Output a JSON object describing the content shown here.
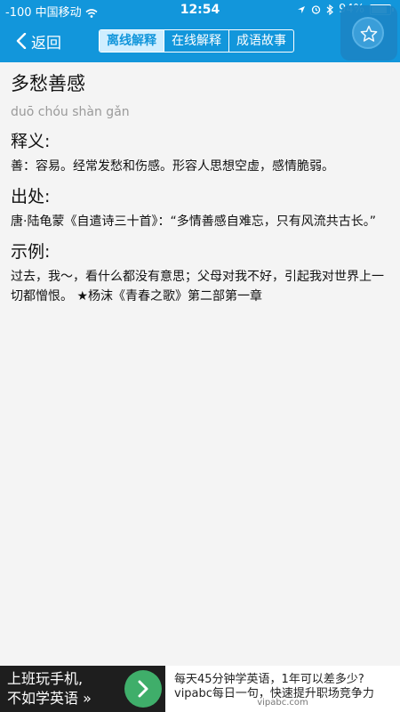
{
  "status_bar": {
    "signal": "-100",
    "carrier": "中国移动",
    "wifi_icon": "wifi-icon",
    "time": "12:54",
    "battery": "94%",
    "battery_level": 0.94
  },
  "nav": {
    "back_label": "返回",
    "tabs": [
      {
        "label": "离线解释",
        "active": true
      },
      {
        "label": "在线解释",
        "active": false
      },
      {
        "label": "成语故事",
        "active": false
      }
    ],
    "favorite_icon": "star-icon"
  },
  "entry": {
    "word": "多愁善感",
    "pinyin": "duō chóu shàn gǎn",
    "definition_heading": "释义:",
    "definition": "善：容易。经常发愁和伤感。形容人思想空虚，感情脆弱。",
    "source_heading": "出处:",
    "source": "唐·陆龟蒙《自遣诗三十首》：“多情善感自难忘，只有风流共古长。”",
    "example_heading": "示例:",
    "example": "过去，我～，看什么都没有意思；父母对我不好，引起我对世界上一切都憎恨。 ★杨沫《青春之歌》第二部第一章"
  },
  "ad": {
    "slogan_line1": "上班玩手机,",
    "slogan_line2": "不如学英语 »",
    "line1": "每天45分钟学英语，1年可以差多少?",
    "line2": "vipabc每日一句，快速提升职场竞争力",
    "url": "vipabc.com"
  }
}
